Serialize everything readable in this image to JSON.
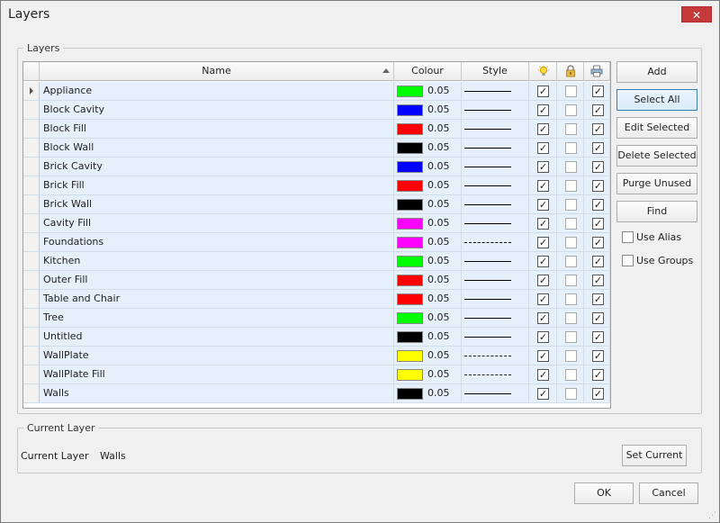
{
  "window": {
    "title": "Layers",
    "close_glyph": "✕"
  },
  "layers_group": {
    "legend": "Layers"
  },
  "columns": {
    "name": "Name",
    "colour": "Colour",
    "style": "Style"
  },
  "header_icons": [
    "bulb-icon",
    "lock-icon",
    "printer-icon"
  ],
  "layers": [
    {
      "name": "Appliance",
      "color": "#00ff00",
      "width": "0.05",
      "style": "solid",
      "visible": true,
      "locked": false,
      "print": true
    },
    {
      "name": "Block Cavity",
      "color": "#0000ff",
      "width": "0.05",
      "style": "solid",
      "visible": true,
      "locked": false,
      "print": true
    },
    {
      "name": "Block Fill",
      "color": "#ff0000",
      "width": "0.05",
      "style": "solid",
      "visible": true,
      "locked": false,
      "print": true
    },
    {
      "name": "Block Wall",
      "color": "#000000",
      "width": "0.05",
      "style": "solid",
      "visible": true,
      "locked": false,
      "print": true
    },
    {
      "name": "Brick Cavity",
      "color": "#0000ff",
      "width": "0.05",
      "style": "solid",
      "visible": true,
      "locked": false,
      "print": true
    },
    {
      "name": "Brick Fill",
      "color": "#ff0000",
      "width": "0.05",
      "style": "solid",
      "visible": true,
      "locked": false,
      "print": true
    },
    {
      "name": "Brick Wall",
      "color": "#000000",
      "width": "0.05",
      "style": "solid",
      "visible": true,
      "locked": false,
      "print": true
    },
    {
      "name": "Cavity Fill",
      "color": "#ff00ff",
      "width": "0.05",
      "style": "solid",
      "visible": true,
      "locked": false,
      "print": true
    },
    {
      "name": "Foundations",
      "color": "#ff00ff",
      "width": "0.05",
      "style": "dashed",
      "visible": true,
      "locked": false,
      "print": true
    },
    {
      "name": "Kitchen",
      "color": "#00ff00",
      "width": "0.05",
      "style": "solid",
      "visible": true,
      "locked": false,
      "print": true
    },
    {
      "name": "Outer Fill",
      "color": "#ff0000",
      "width": "0.05",
      "style": "solid",
      "visible": true,
      "locked": false,
      "print": true
    },
    {
      "name": "Table and Chair",
      "color": "#ff0000",
      "width": "0.05",
      "style": "solid",
      "visible": true,
      "locked": false,
      "print": true
    },
    {
      "name": "Tree",
      "color": "#00ff00",
      "width": "0.05",
      "style": "solid",
      "visible": true,
      "locked": false,
      "print": true
    },
    {
      "name": "Untitled",
      "color": "#000000",
      "width": "0.05",
      "style": "solid",
      "visible": true,
      "locked": false,
      "print": true
    },
    {
      "name": "WallPlate",
      "color": "#ffff00",
      "width": "0.05",
      "style": "dash-dot",
      "visible": true,
      "locked": false,
      "print": true
    },
    {
      "name": "WallPlate Fill",
      "color": "#ffff00",
      "width": "0.05",
      "style": "dash-dot",
      "visible": true,
      "locked": false,
      "print": true
    },
    {
      "name": "Walls",
      "color": "#000000",
      "width": "0.05",
      "style": "solid",
      "visible": true,
      "locked": false,
      "print": true
    }
  ],
  "buttons": {
    "add": "Add",
    "select_all": "Select All",
    "edit_selected": "Edit Selected",
    "delete_selected": "Delete Selected",
    "purge_unused": "Purge Unused",
    "find": "Find"
  },
  "options": {
    "use_alias": {
      "label": "Use Alias",
      "checked": false
    },
    "use_groups": {
      "label": "Use Groups",
      "checked": false
    }
  },
  "current_layer_group": {
    "legend": "Current Layer",
    "label": "Current Layer",
    "value": "Walls",
    "set_current": "Set Current"
  },
  "footer": {
    "ok": "OK",
    "cancel": "Cancel"
  }
}
